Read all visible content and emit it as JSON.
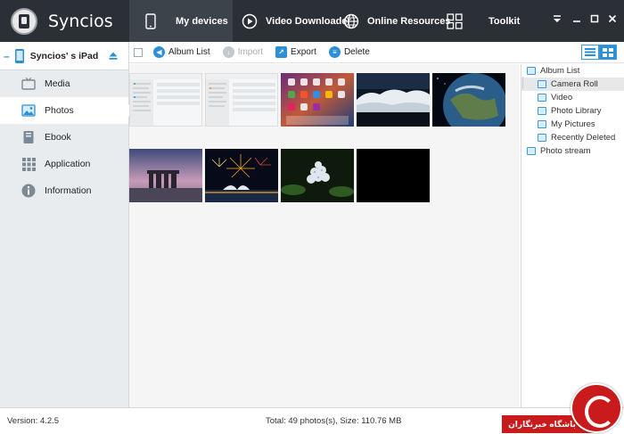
{
  "app": {
    "title": "Syncios"
  },
  "nav": {
    "tabs": [
      {
        "label": "My devices",
        "icon": "phone-icon"
      },
      {
        "label": "Video Downloader",
        "icon": "play-icon"
      },
      {
        "label": "Online Resources",
        "icon": "globe-icon"
      },
      {
        "label": "Toolkit",
        "icon": "grid-icon"
      }
    ],
    "active": "My devices"
  },
  "device": {
    "name": "Syncios' s iPad"
  },
  "sidebar": {
    "items": [
      {
        "label": "Media",
        "icon": "tv-icon"
      },
      {
        "label": "Photos",
        "icon": "picture-icon"
      },
      {
        "label": "Ebook",
        "icon": "book-icon"
      },
      {
        "label": "Application",
        "icon": "apps-icon"
      },
      {
        "label": "Information",
        "icon": "info-icon"
      }
    ],
    "active": "Photos"
  },
  "toolbar": {
    "album_list": "Album List",
    "import": "Import",
    "export": "Export",
    "delete": "Delete"
  },
  "albums": {
    "root": "Album List",
    "children": [
      "Camera Roll",
      "Video",
      "Photo Library",
      "My Pictures",
      "Recently Deleted"
    ],
    "selected": "Camera Roll",
    "stream": "Photo stream"
  },
  "status": {
    "version": "Version: 4.2.5",
    "total": "Total: 49 photos(s), Size: 110.76 MB",
    "watermark": "باشگاه خبرنگاران"
  },
  "colors": {
    "accent": "#2e90d4",
    "topbar": "#2b3036",
    "sidebar": "#e9ecef",
    "watermark": "#c91b1b"
  }
}
